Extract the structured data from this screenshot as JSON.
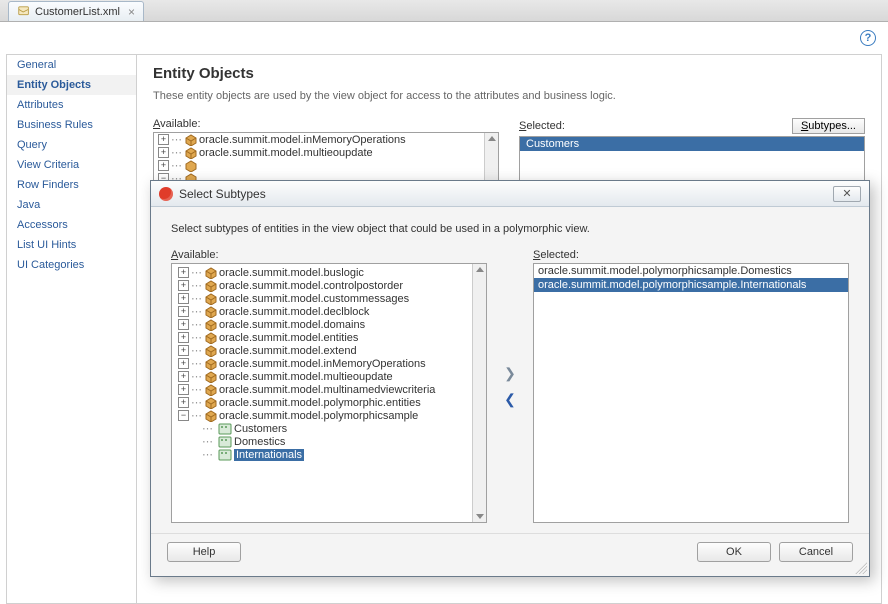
{
  "tab": {
    "filename": "CustomerList.xml"
  },
  "sidebar": {
    "items": [
      {
        "label": "General"
      },
      {
        "label": "Entity Objects",
        "active": true
      },
      {
        "label": "Attributes"
      },
      {
        "label": "Business Rules"
      },
      {
        "label": "Query"
      },
      {
        "label": "View Criteria"
      },
      {
        "label": "Row Finders"
      },
      {
        "label": "Java"
      },
      {
        "label": "Accessors"
      },
      {
        "label": "List UI Hints"
      },
      {
        "label": "UI Categories"
      }
    ]
  },
  "detail": {
    "heading": "Entity Objects",
    "description": "These entity objects are used by the view object for access to the attributes and business logic.",
    "available_label": "Available:",
    "selected_label": "Selected:",
    "subtypes_btn": "Subtypes...",
    "available_tree": [
      "oracle.summit.model.inMemoryOperations",
      "oracle.summit.model.multieoupdate"
    ],
    "selected_list": [
      "Customers"
    ]
  },
  "modal": {
    "title": "Select Subtypes",
    "description": "Select subtypes of entities in the view object that could be used in a polymorphic view.",
    "available_label": "Available:",
    "selected_label": "Selected:",
    "available_packages": [
      "oracle.summit.model.buslogic",
      "oracle.summit.model.controlpostorder",
      "oracle.summit.model.custommessages",
      "oracle.summit.model.declblock",
      "oracle.summit.model.domains",
      "oracle.summit.model.entities",
      "oracle.summit.model.extend",
      "oracle.summit.model.inMemoryOperations",
      "oracle.summit.model.multieoupdate",
      "oracle.summit.model.multinamedviewcriteria",
      "oracle.summit.model.polymorphic.entities"
    ],
    "expanded_package": "oracle.summit.model.polymorphicsample",
    "expanded_children": [
      {
        "label": "Customers",
        "selected": false
      },
      {
        "label": "Domestics",
        "selected": false
      },
      {
        "label": "Internationals",
        "selected": true
      }
    ],
    "selected_list": [
      {
        "label": "oracle.summit.model.polymorphicsample.Domestics",
        "hl": false
      },
      {
        "label": "oracle.summit.model.polymorphicsample.Internationals",
        "hl": true
      }
    ],
    "buttons": {
      "help": "Help",
      "ok": "OK",
      "cancel": "Cancel"
    }
  }
}
